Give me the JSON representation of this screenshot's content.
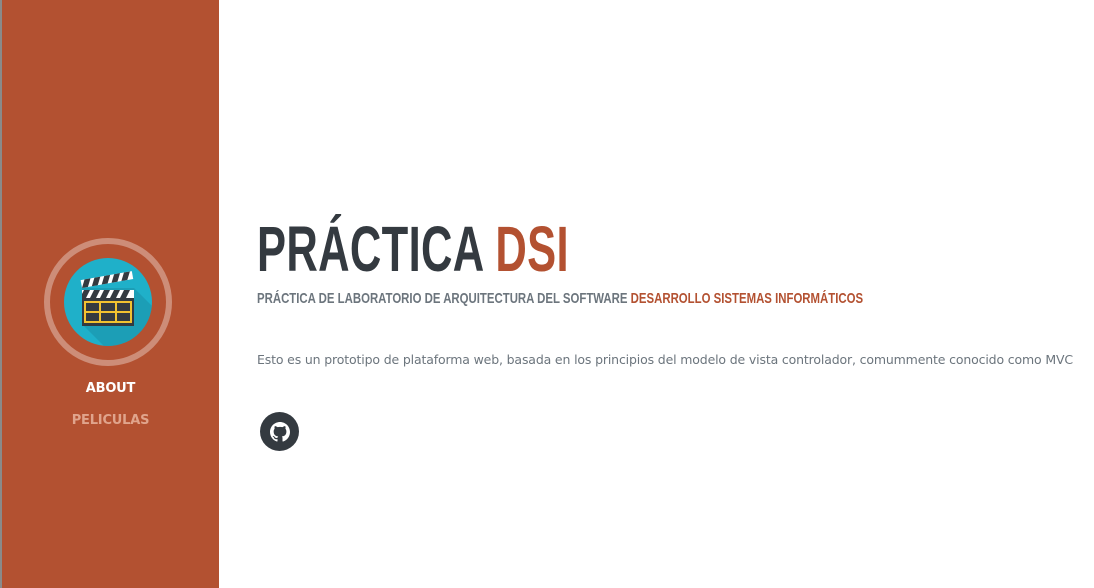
{
  "sidebar": {
    "avatar_icon": "clapperboard-icon",
    "background_color": "#b35131",
    "nav": [
      {
        "label": "ABOUT",
        "active": true
      },
      {
        "label": "PELICULAS",
        "active": false
      }
    ]
  },
  "main": {
    "title_primary": "PRÁCTICA",
    "title_accent": "DSI",
    "subtitle_primary": "PRÁCTICA DE LABORATORIO DE ARQUITECTURA DEL SOFTWARE",
    "subtitle_accent": "DESARROLLO SISTEMAS INFORMÁTICOS",
    "description": "Esto es un prototipo de plataforma web, basada en los principios del modelo de vista controlador, comummente conocido como MVC",
    "social": [
      {
        "icon": "github-icon"
      }
    ]
  },
  "colors": {
    "accent": "#b35131",
    "dark": "#343a40",
    "muted": "#6c757d"
  }
}
